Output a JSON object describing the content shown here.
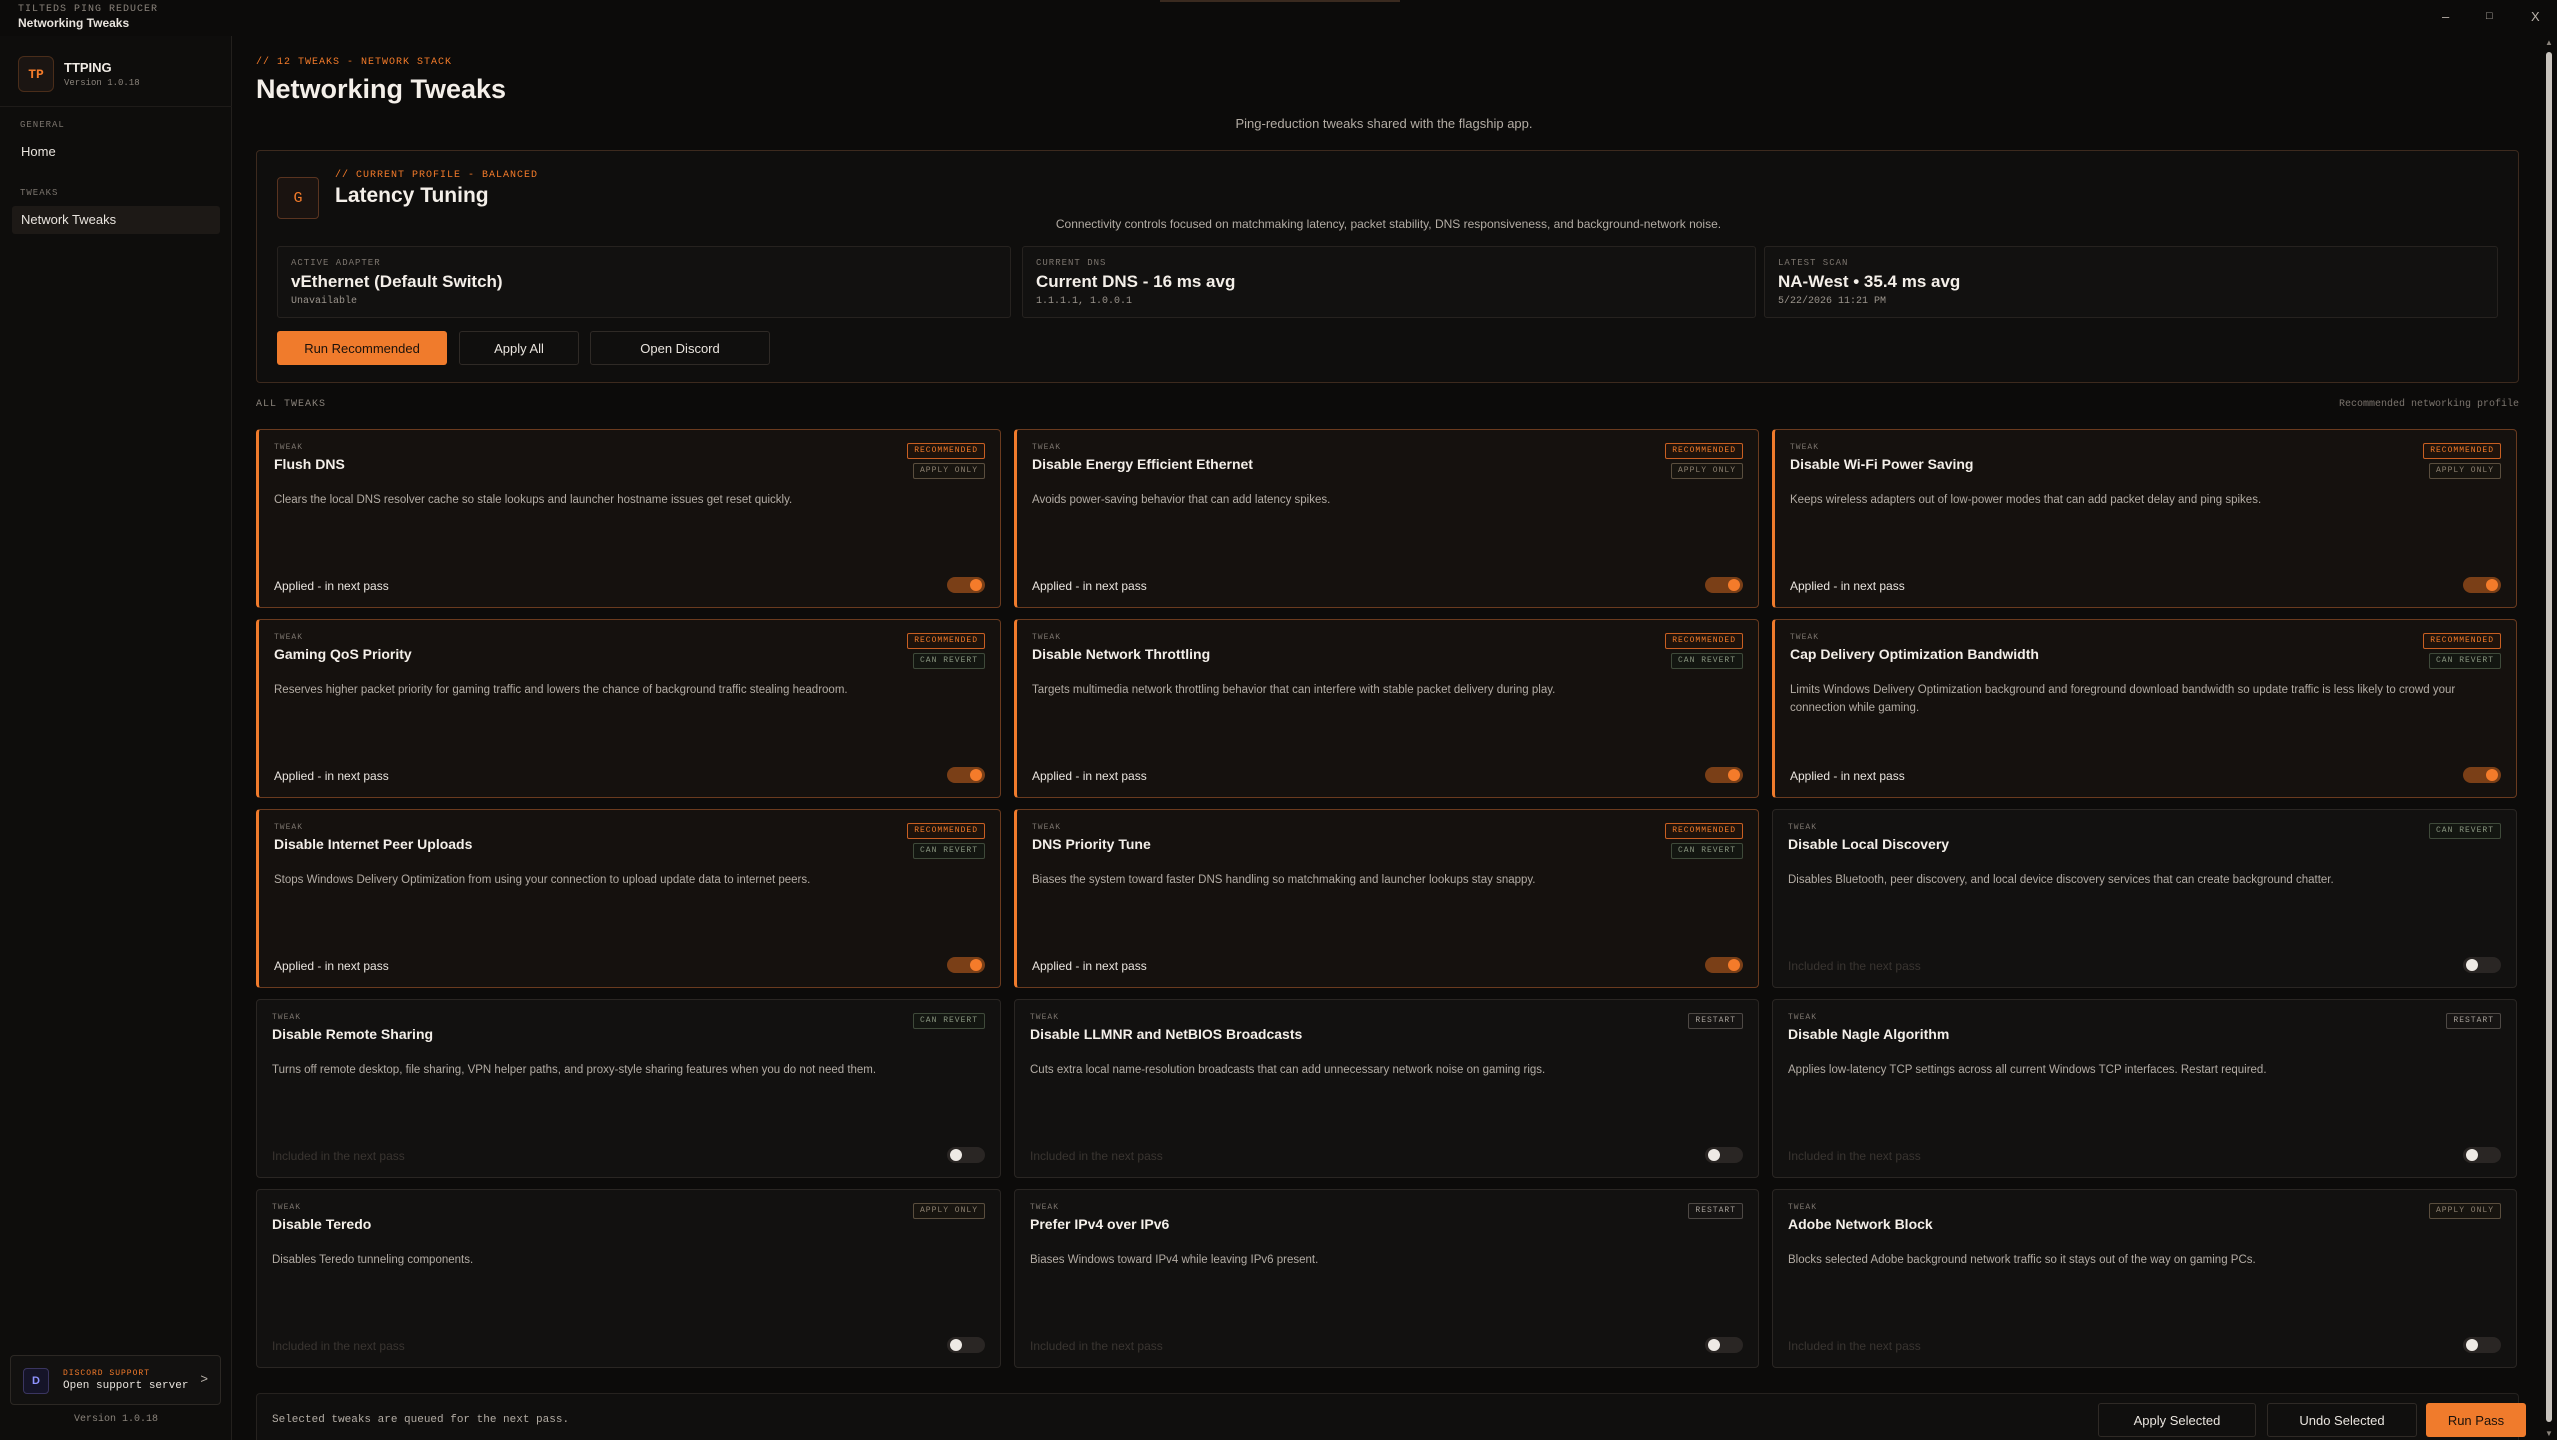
{
  "window": {
    "app_label": "TILTEDS PING REDUCER",
    "title": "Networking Tweaks",
    "minimize": "–",
    "maximize": "□",
    "close": "X"
  },
  "sidebar": {
    "brand_logo": "TP",
    "brand_name": "TTPING",
    "brand_version": "Version 1.0.18",
    "sections": [
      {
        "label": "GENERAL",
        "items": [
          {
            "label": "Home"
          }
        ]
      },
      {
        "label": "TWEAKS",
        "items": [
          {
            "label": "Network Tweaks",
            "active": true
          }
        ]
      }
    ],
    "discord": {
      "icon": "D",
      "tag": "DISCORD SUPPORT",
      "label": "Open support server",
      "arrow": ">"
    },
    "footer_version": "Version 1.0.18"
  },
  "header": {
    "crumb": "// 12 TWEAKS - NETWORK STACK",
    "title": "Networking Tweaks",
    "subtitle": "Ping-reduction tweaks shared with the flagship app."
  },
  "profile": {
    "badge": "G",
    "tag": "// CURRENT PROFILE - BALANCED",
    "title": "Latency Tuning",
    "description": "Connectivity controls focused on matchmaking latency, packet stability, DNS responsiveness, and background-network noise.",
    "stats": [
      {
        "label": "ACTIVE ADAPTER",
        "value": "vEthernet (Default Switch)",
        "sub": "Unavailable"
      },
      {
        "label": "CURRENT DNS",
        "value": "Current DNS - 16 ms avg",
        "sub": "1.1.1.1, 1.0.0.1"
      },
      {
        "label": "LATEST SCAN",
        "value": "NA-West • 35.4 ms avg",
        "sub": "5/22/2026 11:21 PM"
      }
    ],
    "buttons": {
      "run_recommended": "Run Recommended",
      "apply_all": "Apply All",
      "open_discord": "Open Discord"
    }
  },
  "tweaks_section": {
    "label": "ALL TWEAKS",
    "right_label": "Recommended networking profile"
  },
  "tweaks": [
    {
      "tag": "TWEAK",
      "title": "Flush DNS",
      "description": "Clears the local DNS resolver cache so stale lookups and launcher hostname issues get reset quickly.",
      "badges": [
        "RECOMMENDED",
        "APPLY ONLY"
      ],
      "status": "Applied - in next pass",
      "enabled": true
    },
    {
      "tag": "TWEAK",
      "title": "Disable Energy Efficient Ethernet",
      "description": "Avoids power-saving behavior that can add latency spikes.",
      "badges": [
        "RECOMMENDED",
        "APPLY ONLY"
      ],
      "status": "Applied - in next pass",
      "enabled": true
    },
    {
      "tag": "TWEAK",
      "title": "Disable Wi-Fi Power Saving",
      "description": "Keeps wireless adapters out of low-power modes that can add packet delay and ping spikes.",
      "badges": [
        "RECOMMENDED",
        "APPLY ONLY"
      ],
      "status": "Applied - in next pass",
      "enabled": true
    },
    {
      "tag": "TWEAK",
      "title": "Gaming QoS Priority",
      "description": "Reserves higher packet priority for gaming traffic and lowers the chance of background traffic stealing headroom.",
      "badges": [
        "RECOMMENDED",
        "CAN REVERT"
      ],
      "status": "Applied - in next pass",
      "enabled": true
    },
    {
      "tag": "TWEAK",
      "title": "Disable Network Throttling",
      "description": "Targets multimedia network throttling behavior that can interfere with stable packet delivery during play.",
      "badges": [
        "RECOMMENDED",
        "CAN REVERT"
      ],
      "status": "Applied - in next pass",
      "enabled": true
    },
    {
      "tag": "TWEAK",
      "title": "Cap Delivery Optimization Bandwidth",
      "description": "Limits Windows Delivery Optimization background and foreground download bandwidth so update traffic is less likely to crowd your connection while gaming.",
      "badges": [
        "RECOMMENDED",
        "CAN REVERT"
      ],
      "status": "Applied - in next pass",
      "enabled": true
    },
    {
      "tag": "TWEAK",
      "title": "Disable Internet Peer Uploads",
      "description": "Stops Windows Delivery Optimization from using your connection to upload update data to internet peers.",
      "badges": [
        "RECOMMENDED",
        "CAN REVERT"
      ],
      "status": "Applied - in next pass",
      "enabled": true
    },
    {
      "tag": "TWEAK",
      "title": "DNS Priority Tune",
      "description": "Biases the system toward faster DNS handling so matchmaking and launcher lookups stay snappy.",
      "badges": [
        "RECOMMENDED",
        "CAN REVERT"
      ],
      "status": "Applied - in next pass",
      "enabled": true
    },
    {
      "tag": "TWEAK",
      "title": "Disable Local Discovery",
      "description": "Disables Bluetooth, peer discovery, and local device discovery services that can create background chatter.",
      "badges": [
        "CAN REVERT"
      ],
      "status": "Included in the next pass",
      "enabled": false
    },
    {
      "tag": "TWEAK",
      "title": "Disable Remote Sharing",
      "description": "Turns off remote desktop, file sharing, VPN helper paths, and proxy-style sharing features when you do not need them.",
      "badges": [
        "CAN REVERT"
      ],
      "status": "Included in the next pass",
      "enabled": false
    },
    {
      "tag": "TWEAK",
      "title": "Disable LLMNR and NetBIOS Broadcasts",
      "description": "Cuts extra local name-resolution broadcasts that can add unnecessary network noise on gaming rigs.",
      "badges": [
        "RESTART"
      ],
      "status": "Included in the next pass",
      "enabled": false
    },
    {
      "tag": "TWEAK",
      "title": "Disable Nagle Algorithm",
      "description": "Applies low-latency TCP settings across all current Windows TCP interfaces. Restart required.",
      "badges": [
        "RESTART"
      ],
      "status": "Included in the next pass",
      "enabled": false
    },
    {
      "tag": "TWEAK",
      "title": "Disable Teredo",
      "description": "Disables Teredo tunneling components.",
      "badges": [
        "APPLY ONLY"
      ],
      "status": "Included in the next pass",
      "enabled": false
    },
    {
      "tag": "TWEAK",
      "title": "Prefer IPv4 over IPv6",
      "description": "Biases Windows toward IPv4 while leaving IPv6 present.",
      "badges": [
        "RESTART"
      ],
      "status": "Included in the next pass",
      "enabled": false
    },
    {
      "tag": "TWEAK",
      "title": "Adobe Network Block",
      "description": "Blocks selected Adobe background network traffic so it stays out of the way on gaming PCs.",
      "badges": [
        "APPLY ONLY"
      ],
      "status": "Included in the next pass",
      "enabled": false
    }
  ],
  "footer": {
    "text": "Selected tweaks are queued for the next pass.",
    "apply_selected": "Apply Selected",
    "undo_selected": "Undo Selected",
    "run_pass": "Run Pass"
  },
  "colors": {
    "accent": "#f07b2c",
    "background": "#0c0b0a",
    "card": "#121110"
  }
}
